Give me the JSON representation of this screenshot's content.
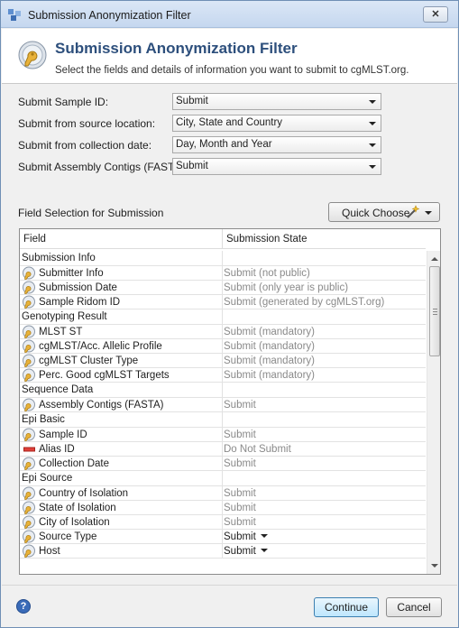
{
  "window": {
    "title": "Submission Anonymization Filter"
  },
  "header": {
    "title": "Submission Anonymization Filter",
    "subtitle": "Select the fields and details of information you want to submit to cgMLST.org."
  },
  "form": [
    {
      "label": "Submit Sample ID:",
      "value": "Submit"
    },
    {
      "label": "Submit from source location:",
      "value": "City, State and Country"
    },
    {
      "label": "Submit from collection date:",
      "value": "Day, Month and Year"
    },
    {
      "label": "Submit Assembly Contigs (FASTA):",
      "value": "Submit"
    }
  ],
  "field_section": {
    "label": "Field Selection for Submission",
    "quick_choose_label": "Quick Choose"
  },
  "table": {
    "columns": [
      "Field",
      "Submission State"
    ],
    "rows": [
      {
        "type": "category",
        "name": "Submission Info",
        "state": ""
      },
      {
        "type": "field",
        "name": "Submitter Info",
        "state": "Submit (not public)",
        "icon": "key-field-icon"
      },
      {
        "type": "field",
        "name": "Submission Date",
        "state": "Submit (only year is public)",
        "icon": "key-field-icon"
      },
      {
        "type": "field",
        "name": "Sample Ridom ID",
        "state": "Submit (generated by cgMLST.org)",
        "icon": "key-field-icon"
      },
      {
        "type": "category",
        "name": "Genotyping Result",
        "state": ""
      },
      {
        "type": "field",
        "name": "MLST ST",
        "state": "Submit (mandatory)",
        "icon": "key-field-icon"
      },
      {
        "type": "field",
        "name": "cgMLST/Acc. Allelic Profile",
        "state": "Submit (mandatory)",
        "icon": "key-field-icon"
      },
      {
        "type": "field",
        "name": "cgMLST Cluster Type",
        "state": "Submit (mandatory)",
        "icon": "key-field-icon"
      },
      {
        "type": "field",
        "name": "Perc. Good cgMLST Targets",
        "state": "Submit (mandatory)",
        "icon": "key-field-icon"
      },
      {
        "type": "category",
        "name": "Sequence Data",
        "state": ""
      },
      {
        "type": "field",
        "name": "Assembly Contigs (FASTA)",
        "state": "Submit",
        "icon": "key-field-icon"
      },
      {
        "type": "category",
        "name": "Epi Basic",
        "state": ""
      },
      {
        "type": "field",
        "name": "Sample ID",
        "state": "Submit",
        "icon": "key-field-icon"
      },
      {
        "type": "field",
        "name": "Alias ID",
        "state": "Do Not Submit",
        "icon": "red-bar-icon"
      },
      {
        "type": "field",
        "name": "Collection Date",
        "state": "Submit",
        "icon": "key-field-icon"
      },
      {
        "type": "category",
        "name": "Epi Source",
        "state": ""
      },
      {
        "type": "field",
        "name": "Country of Isolation",
        "state": "Submit",
        "icon": "key-field-icon"
      },
      {
        "type": "field",
        "name": "State of Isolation",
        "state": "Submit",
        "icon": "key-field-icon"
      },
      {
        "type": "field",
        "name": "City of Isolation",
        "state": "Submit",
        "icon": "key-field-icon"
      },
      {
        "type": "field",
        "name": "Source Type",
        "state": "Submit",
        "icon": "key-field-icon",
        "dropdown": true
      },
      {
        "type": "field",
        "name": "Host",
        "state": "Submit",
        "icon": "key-field-icon",
        "dropdown": true
      }
    ]
  },
  "footer": {
    "continue_label": "Continue",
    "cancel_label": "Cancel"
  },
  "colors": {
    "header_title": "#2d4f7c",
    "primary_button": "#bee6fd",
    "red_bar": "#e0403a"
  }
}
